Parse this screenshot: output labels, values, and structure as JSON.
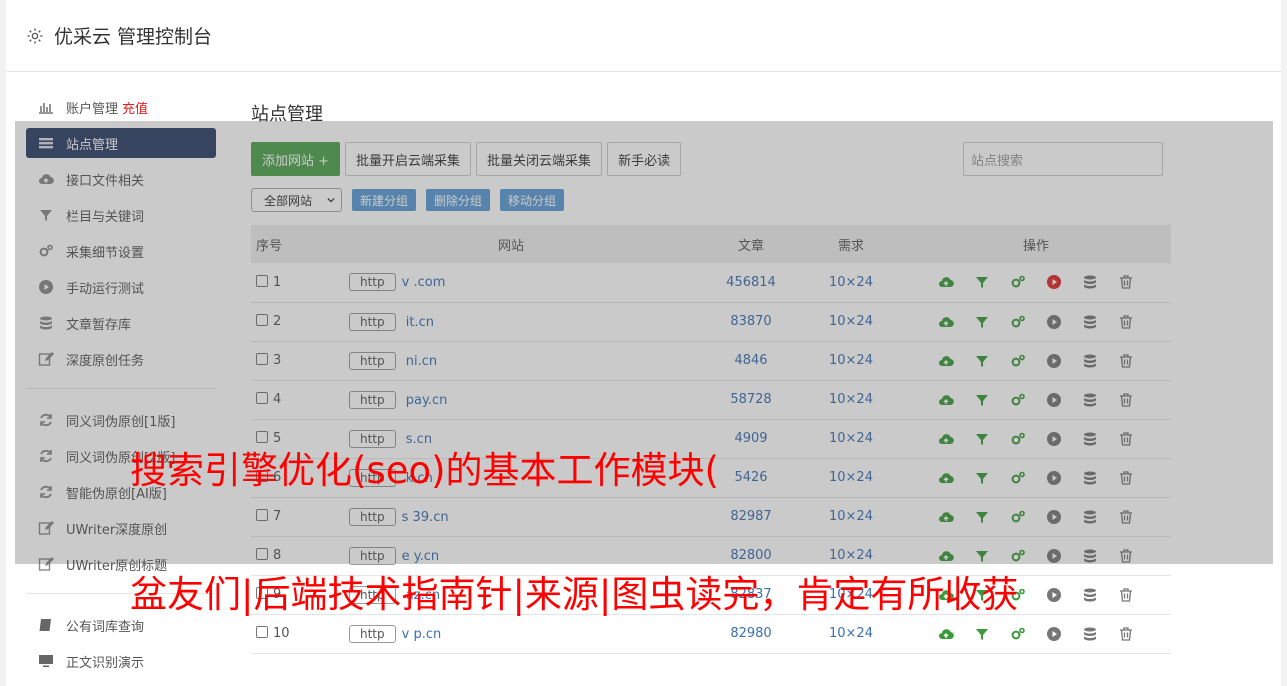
{
  "app": {
    "title": "优采云 管理控制台"
  },
  "sidebar": {
    "items": [
      {
        "label": "账户管理",
        "extra": "充值",
        "icon": "bar-chart-icon"
      },
      {
        "label": "站点管理",
        "icon": "list-icon",
        "active": true
      },
      {
        "label": "接口文件相关",
        "icon": "cloud-upload-icon"
      },
      {
        "label": "栏目与关键词",
        "icon": "filter-icon"
      },
      {
        "label": "采集细节设置",
        "icon": "cogs-icon"
      },
      {
        "label": "手动运行测试",
        "icon": "play-circle-icon"
      },
      {
        "label": "文章暂存库",
        "icon": "database-icon"
      },
      {
        "label": "深度原创任务",
        "icon": "edit-icon"
      }
    ],
    "items2": [
      {
        "label": "同义词伪原创[1版]",
        "icon": "refresh-icon"
      },
      {
        "label": "同义词伪原创[2版]",
        "icon": "refresh-icon"
      },
      {
        "label": "智能伪原创[AI版]",
        "icon": "refresh-icon"
      },
      {
        "label": "UWriter深度原创",
        "icon": "edit-icon"
      },
      {
        "label": "UWriter原创标题",
        "icon": "edit-icon"
      }
    ],
    "items3": [
      {
        "label": "公有词库查询",
        "icon": "book-icon"
      },
      {
        "label": "正文识别演示",
        "icon": "monitor-icon"
      }
    ]
  },
  "main": {
    "title": "站点管理",
    "toolbar": {
      "add_label": "添加网站 +",
      "batch_on_label": "批量开启云端采集",
      "batch_off_label": "批量关闭云端采集",
      "guide_label": "新手必读",
      "search_placeholder": "站点搜索"
    },
    "group_select": "全部网站",
    "group_buttons": [
      "新建分组",
      "删除分组",
      "移动分组"
    ],
    "table": {
      "headers": [
        "序号",
        "网站",
        "文章",
        "需求",
        "操作"
      ],
      "rows": [
        {
          "no": "1",
          "proto": "http",
          "site": "v          .com",
          "articles": "456814",
          "demand": "10×24",
          "running": true
        },
        {
          "no": "2",
          "proto": "http",
          "site": "      it.cn",
          "articles": "83870",
          "demand": "10×24"
        },
        {
          "no": "3",
          "proto": "http",
          "site": "      ni.cn",
          "articles": "4846",
          "demand": "10×24"
        },
        {
          "no": "4",
          "proto": "http",
          "site": "       pay.cn",
          "articles": "58728",
          "demand": "10×24"
        },
        {
          "no": "5",
          "proto": "http",
          "site": "       s.cn",
          "articles": "4909",
          "demand": "10×24"
        },
        {
          "no": "6",
          "proto": "http",
          "site": "      k.cn",
          "articles": "5426",
          "demand": "10×24"
        },
        {
          "no": "7",
          "proto": "http",
          "site": "s    39.cn",
          "articles": "82987",
          "demand": "10×24"
        },
        {
          "no": "8",
          "proto": "http",
          "site": "e      y.cn",
          "articles": "82800",
          "demand": "10×24"
        },
        {
          "no": "9",
          "proto": "http",
          "site": "     az.cn",
          "articles": "82837",
          "demand": "10×24"
        },
        {
          "no": "10",
          "proto": "http",
          "site": "v     p.cn",
          "articles": "82980",
          "demand": "10×24"
        }
      ]
    }
  },
  "watermark": {
    "line1": "搜索引擎优化(seo)的基本工作模块(",
    "line2": "盆友们|后端技术指南针|来源|图虫读完，肯定有所收获",
    "color": "#ff0000"
  },
  "colors": {
    "primary": "#4ea24e",
    "active_nav": "#2b3f66",
    "link": "#3a6fb0",
    "group_btn": "#5b9bd5"
  }
}
